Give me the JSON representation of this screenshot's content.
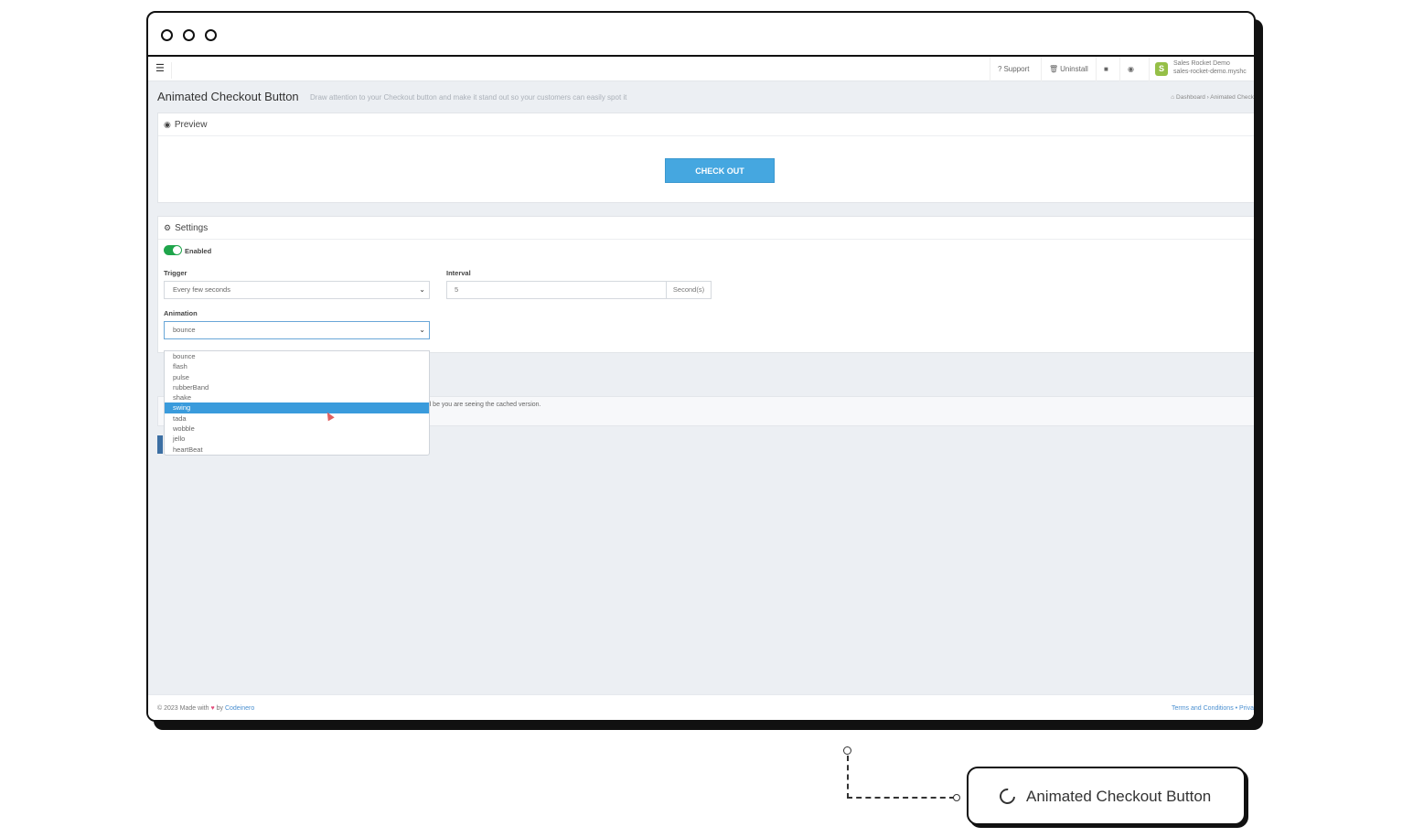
{
  "nav": {
    "support": "Support",
    "uninstall": "Uninstall",
    "store_name": "Sales Rocket Demo",
    "store_domain": "sales-rocket-demo.myshc"
  },
  "page": {
    "title": "Animated Checkout Button",
    "subtitle": "Draw attention to your Checkout button and make it stand out so your customers can easily spot it",
    "breadcrumb_home": "Dashboard",
    "breadcrumb_current": "Animated Check"
  },
  "preview": {
    "heading": "Preview",
    "button_label": "CHECK OUT"
  },
  "settings": {
    "heading": "Settings",
    "enabled_label": "Enabled",
    "trigger_label": "Trigger",
    "trigger_value": "Every few seconds",
    "interval_label": "Interval",
    "interval_value": "5",
    "interval_unit": "Second(s)",
    "animation_label": "Animation",
    "animation_value": "bounce",
    "animation_options": [
      "bounce",
      "flash",
      "pulse",
      "rubberBand",
      "shake",
      "swing",
      "tada",
      "wobble",
      "jello",
      "heartBeat"
    ],
    "highlighted_option": "swing"
  },
  "notice": {
    "text": "ould be you are seeing the cached version."
  },
  "footer": {
    "left": "© 2023 Made with",
    "by": "by",
    "brand": "Codeinero",
    "right": "Terms and Conditions • Priva"
  },
  "callout": {
    "label": "Animated Checkout Button"
  },
  "colors": {
    "accent": "#45a7e0",
    "toggle_on": "#1fa54b",
    "selected_option": "#3a9bdc"
  }
}
